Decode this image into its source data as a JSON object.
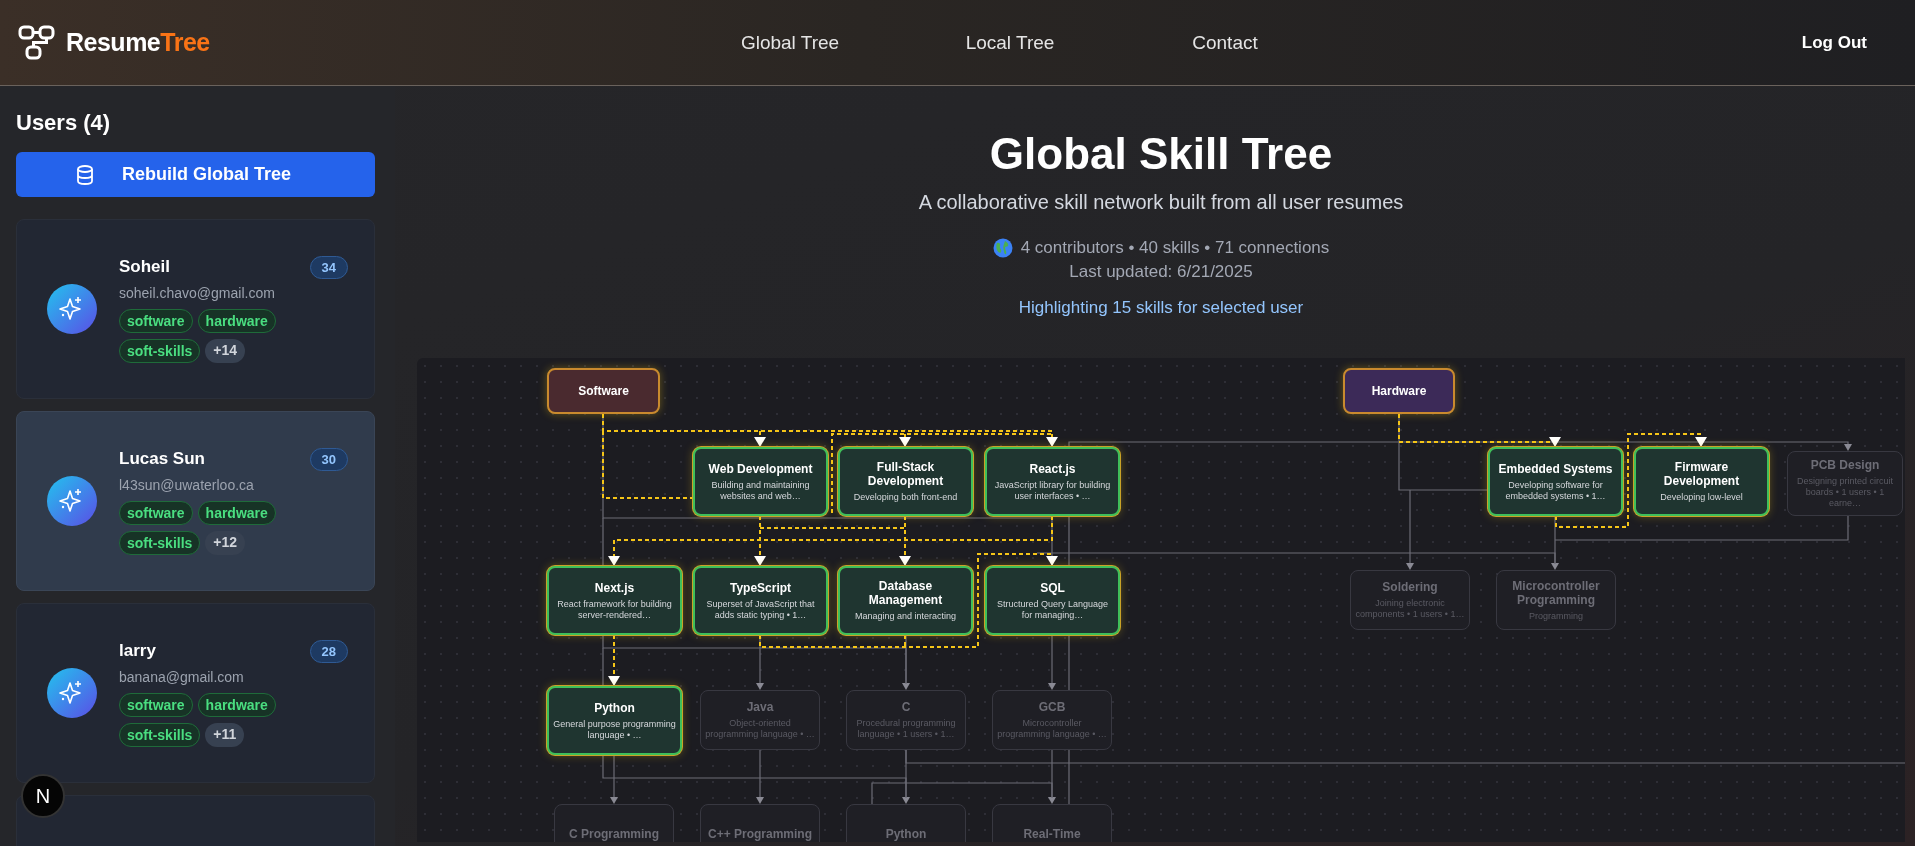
{
  "header": {
    "logo": {
      "text": "Resume",
      "accent": "Tree"
    },
    "nav": [
      {
        "label": "Global Tree"
      },
      {
        "label": "Local Tree"
      },
      {
        "label": "Contact"
      }
    ],
    "logout": "Log Out"
  },
  "sidebar": {
    "title": "Users (4)",
    "rebuild_button": "Rebuild Global Tree",
    "users": [
      {
        "name": "Soheil",
        "email": "soheil.chavo@gmail.com",
        "count": "34",
        "tags": [
          "software",
          "hardware",
          "soft-skills"
        ],
        "more": "+14",
        "selected": false
      },
      {
        "name": "Lucas Sun",
        "email": "l43sun@uwaterloo.ca",
        "count": "30",
        "tags": [
          "software",
          "hardware",
          "soft-skills"
        ],
        "more": "+12",
        "selected": true
      },
      {
        "name": "larry",
        "email": "banana@gmail.com",
        "count": "28",
        "tags": [
          "software",
          "hardware",
          "soft-skills"
        ],
        "more": "+11",
        "selected": false
      }
    ]
  },
  "main": {
    "title": "Global Skill Tree",
    "subtitle": "A collaborative skill network built from all user resumes",
    "stats": "4 contributors • 40 skills • 71 connections",
    "updated": "Last updated: 6/21/2025",
    "highlight": "Highlighting 15 skills for selected user",
    "tree": {
      "nodes": [
        {
          "kind": "category",
          "title": "Software",
          "color": "#4a2a2f"
        },
        {
          "kind": "category",
          "title": "Hardware",
          "color": "#3c2a58"
        },
        {
          "kind": "skill",
          "title": "Web Development",
          "description": "Building and maintaining websites and web…",
          "highlighted": true
        },
        {
          "kind": "skill",
          "title": "Full-Stack Development",
          "description": "Developing both front-end",
          "highlighted": true
        },
        {
          "kind": "skill",
          "title": "React.js",
          "description": "JavaScript library for building user interfaces • …",
          "highlighted": true
        },
        {
          "kind": "skill",
          "title": "Embedded Systems",
          "description": "Developing software for embedded systems • 1…",
          "highlighted": true
        },
        {
          "kind": "skill",
          "title": "Firmware Development",
          "description": "Developing low-level",
          "highlighted": true
        },
        {
          "kind": "skill",
          "title": "PCB Design",
          "description": "Designing printed circuit boards • 1 users • 1 earne…",
          "highlighted": false
        },
        {
          "kind": "skill",
          "title": "Next.js",
          "description": "React framework for building server-rendered…",
          "highlighted": true
        },
        {
          "kind": "skill",
          "title": "TypeScript",
          "description": "Superset of JavaScript that adds static typing • 1…",
          "highlighted": true
        },
        {
          "kind": "skill",
          "title": "Database Management",
          "description": "Managing and interacting",
          "highlighted": true
        },
        {
          "kind": "skill",
          "title": "SQL",
          "description": "Structured Query Language for managing…",
          "highlighted": true
        },
        {
          "kind": "skill",
          "title": "Soldering",
          "description": "Joining electronic components • 1 users • 1…",
          "highlighted": false
        },
        {
          "kind": "skill",
          "title": "Microcontroller Programming",
          "description": "Programming",
          "highlighted": false
        },
        {
          "kind": "skill",
          "title": "Python",
          "description": "General purpose programming language • …",
          "highlighted": true
        },
        {
          "kind": "skill",
          "title": "Java",
          "description": "Object-oriented programming language • …",
          "highlighted": false
        },
        {
          "kind": "skill",
          "title": "C",
          "description": "Procedural programming language • 1 users • 1…",
          "highlighted": false
        },
        {
          "kind": "skill",
          "title": "GCB",
          "description": "Microcontroller programming language • …",
          "highlighted": false
        },
        {
          "kind": "skill",
          "title": "C Programming",
          "highlighted": false
        },
        {
          "kind": "skill",
          "title": "C++ Programming",
          "highlighted": false
        },
        {
          "kind": "skill",
          "title": "Python",
          "highlighted": false
        },
        {
          "kind": "skill",
          "title": "Real-Time",
          "highlighted": false
        }
      ]
    }
  },
  "dev_badge": "N"
}
